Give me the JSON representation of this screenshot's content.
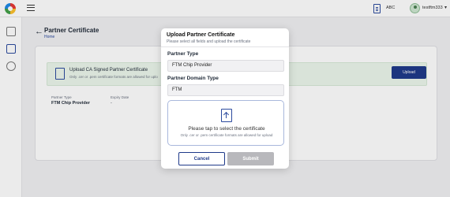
{
  "topbar": {
    "org": "ABC",
    "user": "testftm333"
  },
  "page": {
    "title": "Partner Certificate",
    "breadcrumb": "Home"
  },
  "card": {
    "upload_title": "Upload CA Signed Partner Certificate",
    "upload_hint": "Only .cer or .pem certificate formats are allowed for uplo",
    "upload_button": "Upload",
    "partner_type_label": "Partner Type",
    "partner_type_value": "FTM Chip Provider",
    "expiry_label": "Expiry Date",
    "expiry_value": "-"
  },
  "modal": {
    "title": "Upload Partner Certificate",
    "subtitle": "Please select all fields and upload the certificate",
    "partner_type_label": "Partner Type",
    "partner_type_value": "FTM Chip Provider",
    "domain_label": "Partner Domain Type",
    "domain_value": "FTM",
    "drop_text": "Please tap to select the certificate",
    "drop_hint": "Only .cer or .pem certificate formats are allowed for upload",
    "cancel": "Cancel",
    "submit": "Submit"
  },
  "colors": {
    "primary": "#1f3a8a",
    "disabled": "#b8b8bc",
    "upload_row_bg": "#ecf7ec"
  }
}
